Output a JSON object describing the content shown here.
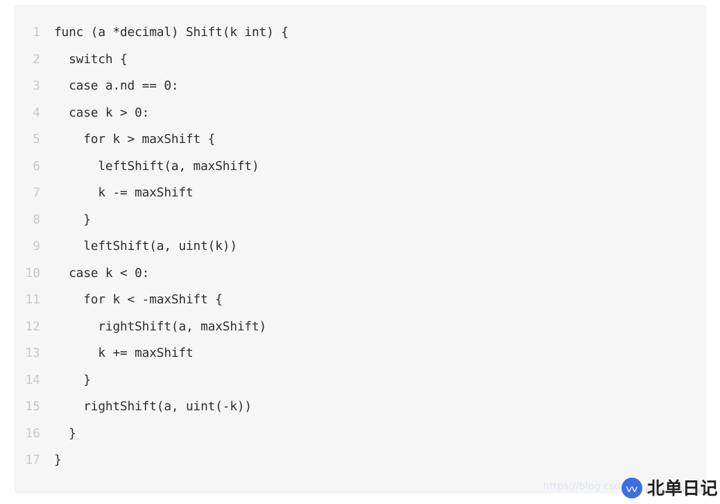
{
  "code_block": {
    "language": "go",
    "background_color": "#f6f6f6",
    "text_color": "#2d2d2d",
    "line_number_color": "#c9c9c9",
    "lines": [
      {
        "number": "1",
        "text": "func (a *decimal) Shift(k int) {"
      },
      {
        "number": "2",
        "text": "  switch {"
      },
      {
        "number": "3",
        "text": "  case a.nd == 0:"
      },
      {
        "number": "4",
        "text": "  case k > 0:"
      },
      {
        "number": "5",
        "text": "    for k > maxShift {"
      },
      {
        "number": "6",
        "text": "      leftShift(a, maxShift)"
      },
      {
        "number": "7",
        "text": "      k -= maxShift"
      },
      {
        "number": "8",
        "text": "    }"
      },
      {
        "number": "9",
        "text": "    leftShift(a, uint(k))"
      },
      {
        "number": "10",
        "text": "  case k < 0:"
      },
      {
        "number": "11",
        "text": "    for k < -maxShift {"
      },
      {
        "number": "12",
        "text": "      rightShift(a, maxShift)"
      },
      {
        "number": "13",
        "text": "      k += maxShift"
      },
      {
        "number": "14",
        "text": "    }"
      },
      {
        "number": "15",
        "text": "    rightShift(a, uint(-k))"
      },
      {
        "number": "16",
        "text": "  }"
      },
      {
        "number": "17",
        "text": "}"
      }
    ]
  },
  "watermark": {
    "url_text": "https://blog.csdn.",
    "overlay_text": "blog.csdn.net",
    "url_color": "#dfe6ef"
  },
  "brand": {
    "name": "北单日记",
    "logo_icon": "double-check-logo-icon",
    "logo_color": "#3b6fe0",
    "text_color": "#1d1d1d"
  }
}
